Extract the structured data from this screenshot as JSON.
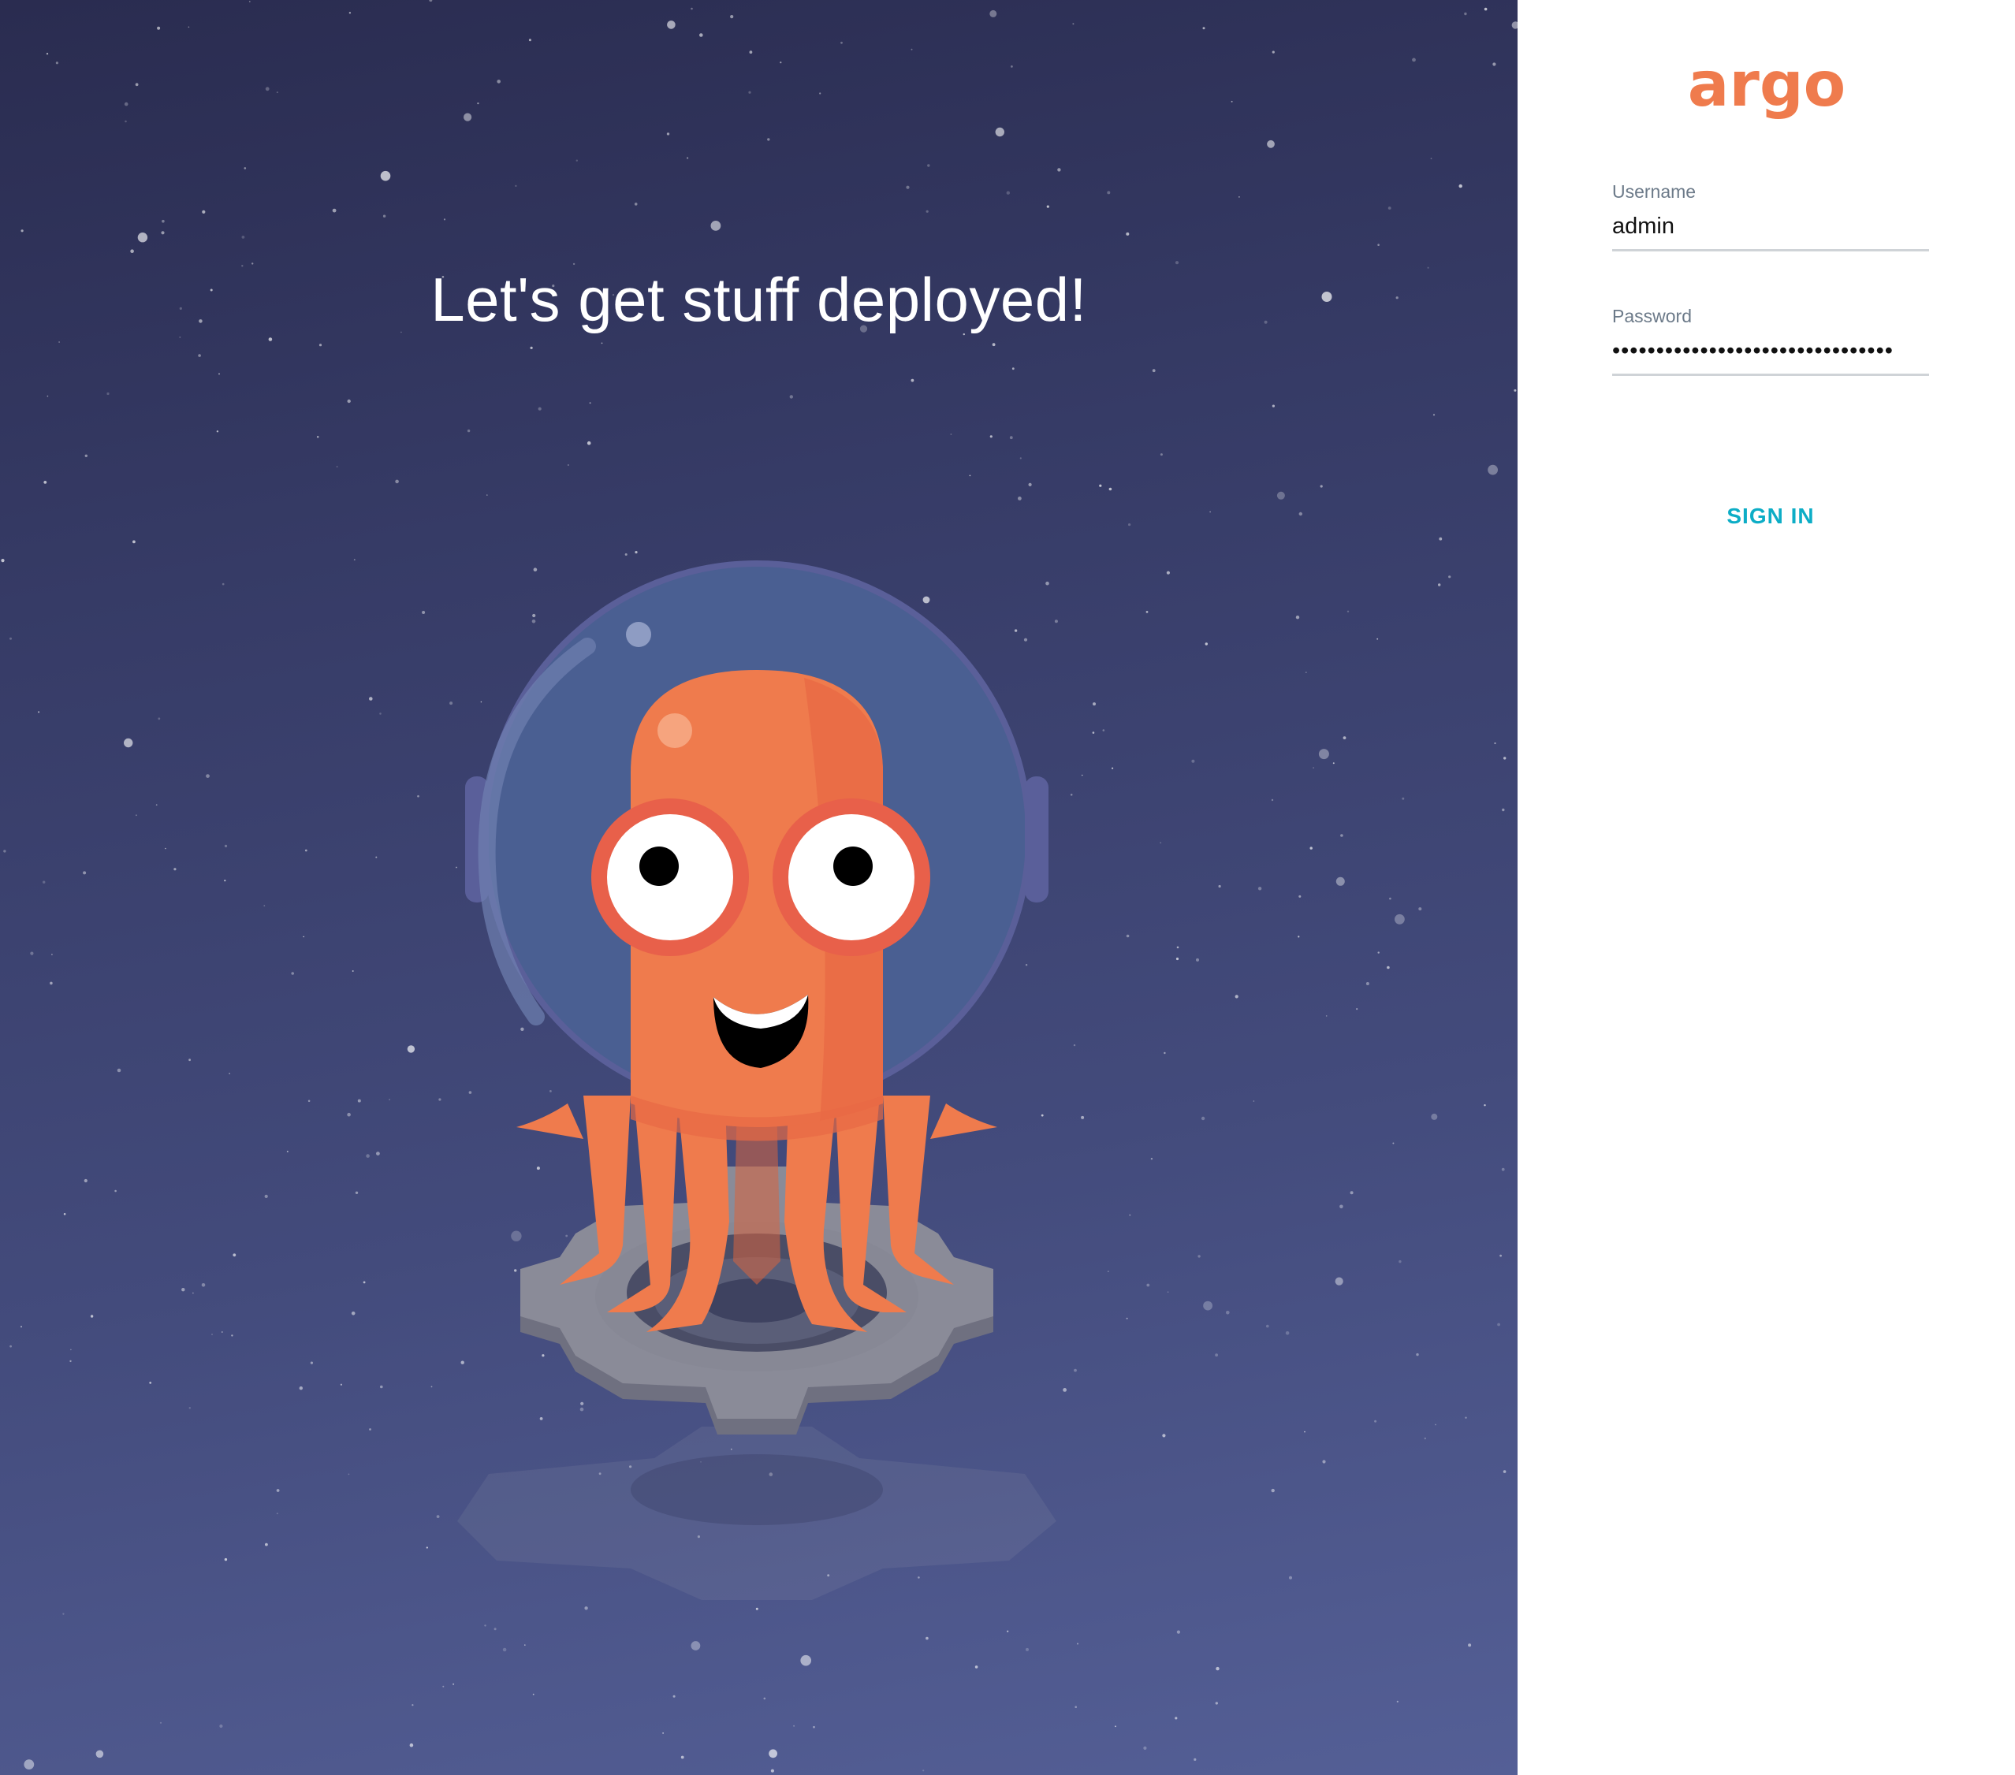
{
  "hero": {
    "tagline": "Let's get stuff deployed!",
    "mascot_icon": "argo-octopus-astronaut-icon"
  },
  "login": {
    "logo_text": "argo",
    "username": {
      "label": "Username",
      "value": "admin"
    },
    "password": {
      "label": "Password",
      "value": "••••••••••••••••••••••••••••••••"
    },
    "submit_label": "SIGN IN"
  },
  "colors": {
    "brand_orange": "#ef7b4d",
    "accent_teal": "#0dadc6",
    "hero_background": "#3b4270"
  }
}
